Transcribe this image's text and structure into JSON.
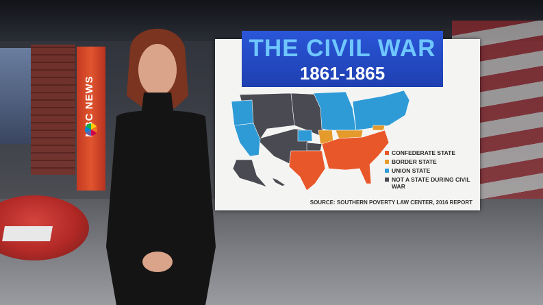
{
  "broadcast": {
    "network_label": "NBC NEWS"
  },
  "graphic": {
    "title": "THE CIVIL WAR",
    "years": "1861-1865",
    "legend": [
      {
        "label": "CONFEDERATE STATE",
        "color": "#e8572a"
      },
      {
        "label": "BORDER STATE",
        "color": "#e59a2c"
      },
      {
        "label": "UNION STATE",
        "color": "#2f9bd6"
      },
      {
        "label": "NOT A STATE DURING CIVIL WAR",
        "color": "#4a4a52"
      }
    ],
    "source": "SOURCE: SOUTHERN POVERTY LAW CENTER, 2016 REPORT"
  },
  "colors": {
    "confederate": "#e8572a",
    "border": "#e59a2c",
    "union": "#2f9bd6",
    "territory": "#4a4a52",
    "banner": "#1e3fb0"
  }
}
